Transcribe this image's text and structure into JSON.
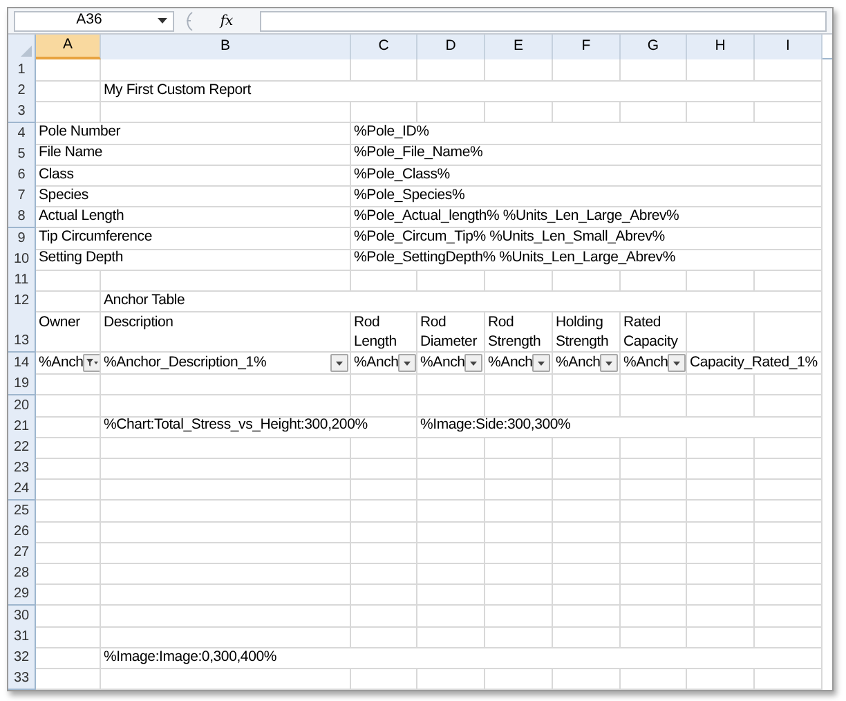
{
  "formula_bar": {
    "name_box": "A36",
    "function_symbol": "fx"
  },
  "columns": [
    {
      "label": "A",
      "selected": true
    },
    {
      "label": "B",
      "selected": false
    },
    {
      "label": "C",
      "selected": false
    },
    {
      "label": "D",
      "selected": false
    },
    {
      "label": "E",
      "selected": false
    },
    {
      "label": "F",
      "selected": false
    },
    {
      "label": "G",
      "selected": false
    },
    {
      "label": "H",
      "selected": false
    },
    {
      "label": "I",
      "selected": false
    }
  ],
  "rows": [
    {
      "number": "1"
    },
    {
      "number": "2",
      "cells": [
        null,
        {
          "text": "My First Custom Report"
        }
      ]
    },
    {
      "number": "3"
    },
    {
      "number": "4",
      "cells": [
        {
          "text": "Pole Number"
        },
        null,
        {
          "text": "%Pole_ID%"
        }
      ]
    },
    {
      "number": "5",
      "cells": [
        {
          "text": "File Name"
        },
        null,
        {
          "text": "%Pole_File_Name%"
        }
      ]
    },
    {
      "number": "6",
      "cells": [
        {
          "text": "Class"
        },
        null,
        {
          "text": "%Pole_Class%"
        }
      ]
    },
    {
      "number": "7",
      "cells": [
        {
          "text": "Species"
        },
        null,
        {
          "text": "%Pole_Species%"
        }
      ]
    },
    {
      "number": "8",
      "cells": [
        {
          "text": "Actual Length"
        },
        null,
        {
          "text": "%Pole_Actual_length% %Units_Len_Large_Abrev%"
        }
      ]
    },
    {
      "number": "9",
      "cells": [
        {
          "text": "Tip Circumference"
        },
        null,
        {
          "text": "%Pole_Circum_Tip% %Units_Len_Small_Abrev%"
        }
      ]
    },
    {
      "number": "10",
      "cells": [
        {
          "text": "Setting Depth"
        },
        null,
        {
          "text": "%Pole_SettingDepth% %Units_Len_Large_Abrev%"
        }
      ]
    },
    {
      "number": "11"
    },
    {
      "number": "12",
      "cells": [
        null,
        {
          "text": "Anchor Table"
        }
      ]
    },
    {
      "number": "13",
      "tall": true,
      "cells": [
        {
          "text": "Owner"
        },
        {
          "text": "Description"
        },
        {
          "text": "Rod Length"
        },
        {
          "text": "Rod Diameter"
        },
        {
          "text": "Rod Strength"
        },
        {
          "text": "Holding Strength"
        },
        {
          "text": "Rated Capacity"
        }
      ]
    },
    {
      "number": "14",
      "cells": [
        {
          "text": "%Anch",
          "dropdown": true,
          "filtered": true
        },
        {
          "text": "%Anchor_Description_1%",
          "dropdown": true,
          "filtered": false
        },
        {
          "text": "%Anch",
          "dropdown": true,
          "filtered": false
        },
        {
          "text": "%Anch",
          "dropdown": true,
          "filtered": false
        },
        {
          "text": "%Anch",
          "dropdown": true,
          "filtered": false
        },
        {
          "text": "%Anch",
          "dropdown": true,
          "filtered": false
        },
        {
          "text": "%Anch",
          "dropdown": true,
          "filtered": false
        },
        {
          "text": "Capacity_Rated_1%"
        }
      ]
    },
    {
      "number": "19"
    },
    {
      "number": "20"
    },
    {
      "number": "21",
      "cells": [
        null,
        {
          "text": "%Chart:Total_Stress_vs_Height:300,200%"
        },
        null,
        {
          "text": "%Image:Side:300,300%"
        }
      ]
    },
    {
      "number": "22"
    },
    {
      "number": "23"
    },
    {
      "number": "24"
    },
    {
      "number": "25"
    },
    {
      "number": "26"
    },
    {
      "number": "27"
    },
    {
      "number": "28"
    },
    {
      "number": "29"
    },
    {
      "number": "30"
    },
    {
      "number": "31"
    },
    {
      "number": "32",
      "cells": [
        null,
        {
          "text": "%Image:Image:0,300,400%"
        }
      ]
    },
    {
      "number": "33"
    }
  ]
}
